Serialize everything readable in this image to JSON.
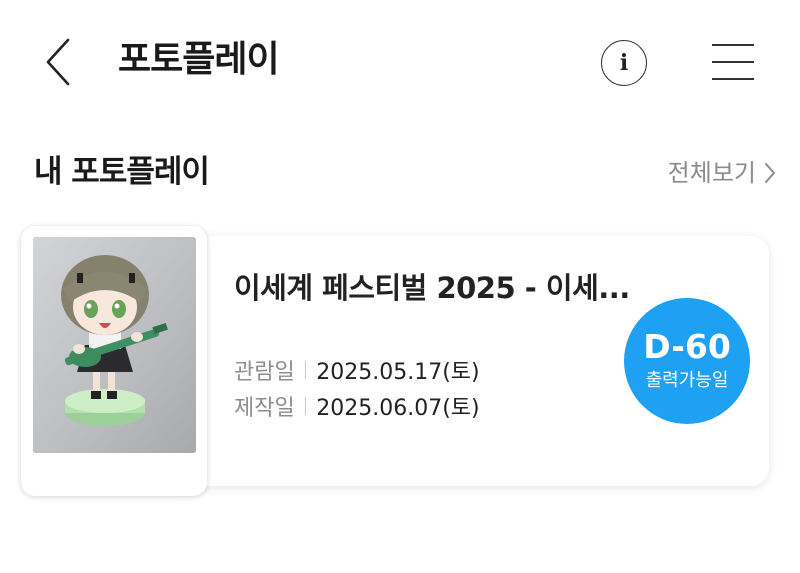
{
  "header": {
    "title": "포토플레이",
    "back_icon": "chevron-left-icon",
    "info_icon": "info-icon",
    "info_glyph": "i",
    "menu_icon": "hamburger-menu-icon"
  },
  "section": {
    "title": "내 포토플레이",
    "view_all_label": "전체보기",
    "view_all_icon": "chevron-right-icon"
  },
  "cards": [
    {
      "title": "이세계 페스티벌 2025 - 이세...",
      "viewing_label": "관람일",
      "viewing_date": "2025.05.17(토)",
      "created_label": "제작일",
      "created_date": "2025.06.07(토)",
      "dday": "D-60",
      "dday_caption": "출력가능일",
      "photo_icon": "figure-photo-thumbnail"
    }
  ],
  "colors": {
    "accent": "#1ea1f3",
    "text_primary": "#222222",
    "text_secondary": "#8e8e8e"
  }
}
